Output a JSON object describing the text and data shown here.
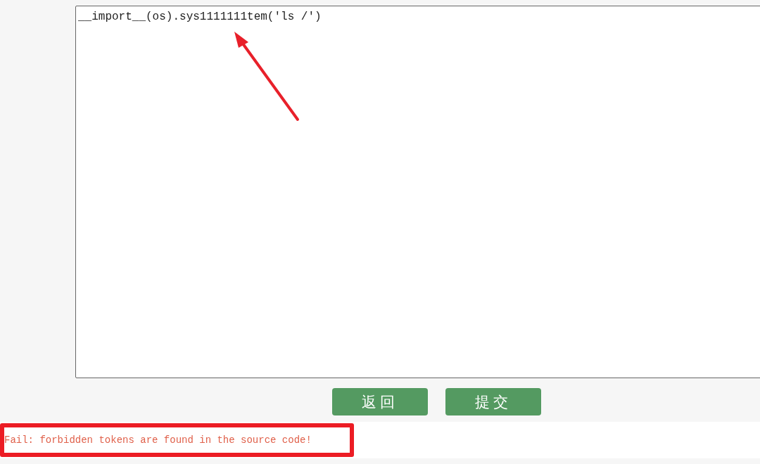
{
  "editor": {
    "value": "__import__(os).sys1111111tem('ls /')"
  },
  "buttons": [
    {
      "label": "返回"
    },
    {
      "label": "提交"
    }
  ],
  "message": {
    "text": "Fail: forbidden tokens are found in the source code!"
  }
}
